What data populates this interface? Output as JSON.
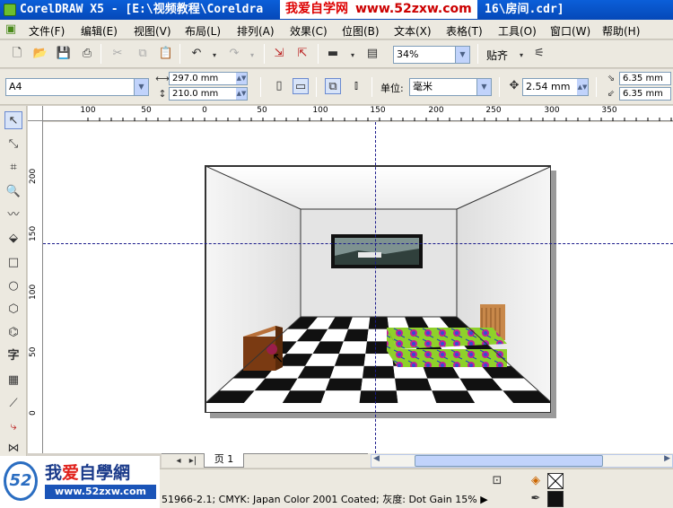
{
  "window": {
    "title": "CorelDRAW X5 - [E:\\视频教程\\Coreldra",
    "title_tail": "16\\房间.cdr]"
  },
  "banner": {
    "text": "我爱自学网",
    "url": "www.52zxw.com"
  },
  "menu": [
    {
      "label": "文件(F)"
    },
    {
      "label": "编辑(E)"
    },
    {
      "label": "视图(V)"
    },
    {
      "label": "布局(L)"
    },
    {
      "label": "排列(A)"
    },
    {
      "label": "效果(C)"
    },
    {
      "label": "位图(B)"
    },
    {
      "label": "文本(X)"
    },
    {
      "label": "表格(T)"
    },
    {
      "label": "工具(O)"
    },
    {
      "label": "窗口(W)"
    },
    {
      "label": "帮助(H)"
    }
  ],
  "toolbar": {
    "zoom_value": "34%",
    "snap_label": "贴齐",
    "icons": [
      "new-icon",
      "open-icon",
      "save-icon",
      "print-icon",
      "cut-icon",
      "copy-icon",
      "paste-icon",
      "undo-icon",
      "redo-icon",
      "import-icon",
      "export-icon",
      "app-launcher-icon",
      "zoom-icon",
      "align-icon"
    ]
  },
  "property_bar": {
    "page_size": "A4",
    "width": "297.0 mm",
    "height": "210.0 mm",
    "units_label": "单位:",
    "units_value": "毫米",
    "nudge_value": "2.54 mm",
    "dup_x": "6.35 mm",
    "dup_y": "6.35 mm"
  },
  "toolbox": {
    "tools": [
      "pick-tool",
      "shape-tool",
      "crop-tool",
      "zoom-tool",
      "freehand-tool",
      "smart-fill-tool",
      "rectangle-tool",
      "ellipse-tool",
      "polygon-tool",
      "basic-shapes-tool",
      "text-tool",
      "table-tool",
      "dimension-tool",
      "connector-tool",
      "blend-tool"
    ],
    "text_tool_glyph": "字"
  },
  "rulers": {
    "h_ticks": [
      "100",
      "50",
      "0",
      "50",
      "100",
      "150",
      "200",
      "250",
      "300",
      "350"
    ],
    "v_ticks": [
      "200",
      "150",
      "100",
      "50",
      "0"
    ]
  },
  "pages": {
    "current": "页 1"
  },
  "status": {
    "color_profile": "51966-2.1; CMYK: Japan Color 2001 Coated; 灰度: Dot Gain 15%"
  },
  "logo": {
    "name_a": "我",
    "name_heart": "爱",
    "name_b": "自學網",
    "url": "www.52zxw.com",
    "mark": "52"
  },
  "colors": {
    "title_bar": "#0548b8",
    "chrome": "#ece9e0",
    "guide": "#1a1a8a",
    "bed_cover": "#8ed12a",
    "floor_dark": "#111111"
  }
}
